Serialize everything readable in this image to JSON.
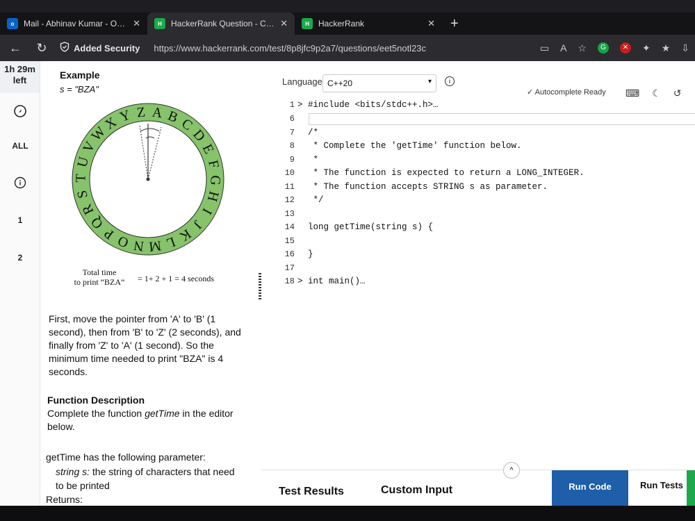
{
  "tabs": [
    {
      "label": "Mail - Abhinav Kumar - Outlook",
      "icon": "outlook-icon",
      "close": "✕"
    },
    {
      "label": "HackerRank Question - Circula",
      "icon": "hackerrank-icon",
      "close": "✕"
    },
    {
      "label": "HackerRank",
      "icon": "hackerrank-icon",
      "close": "✕"
    }
  ],
  "address": {
    "security_label": "Added Security",
    "url": "https://www.hackerrank.com/test/8p8jfc9p2a7/questions/eet5notl23c"
  },
  "leftnav": {
    "timer_line1": "1h 29m",
    "timer_line2": "left",
    "all_label": "ALL",
    "q1": "1",
    "q2": "2"
  },
  "problem": {
    "example_heading": "Example",
    "example_s": "s = \"BZA\"",
    "wheel_letters": [
      "Z",
      "A",
      "B",
      "C",
      "D",
      "E",
      "F",
      "G",
      "H",
      "I",
      "J",
      "K",
      "L",
      "M",
      "N",
      "O",
      "P",
      "Q",
      "R",
      "S",
      "T",
      "U",
      "V",
      "W",
      "X",
      "Y"
    ],
    "total_label_1": "Total time",
    "total_label_2": "to print “BZA”",
    "total_equation": "= 1+ 2 + 1 = 4 seconds",
    "paragraph": "First, move the pointer from 'A' to 'B' (1 second), then from 'B' to 'Z' (2 seconds), and finally from 'Z' to 'A' (1 second). So the minimum time needed to print \"BZA\" is 4 seconds.",
    "function_description_heading": "Function Description",
    "function_description_pre": "Complete the function ",
    "function_name": "getTime",
    "function_description_post": " in the editor below.",
    "param_line": "getTime has the following parameter:",
    "param_item_name": "string s:",
    "param_item_desc": " the string of characters that need to be printed",
    "returns_label": "Returns:"
  },
  "editor": {
    "language_label": "Language",
    "language_value": "C++20",
    "autocomplete_status": "Autocomplete Ready",
    "lines": [
      {
        "num": "1",
        "text": "> #include <bits/stdc++.h>…"
      },
      {
        "num": "6",
        "text": ""
      },
      {
        "num": "7",
        "text": "  /*"
      },
      {
        "num": "8",
        "text": "   * Complete the 'getTime' function below."
      },
      {
        "num": "9",
        "text": "   *"
      },
      {
        "num": "10",
        "text": "   * The function is expected to return a LONG_INTEGER."
      },
      {
        "num": "11",
        "text": "   * The function accepts STRING s as parameter."
      },
      {
        "num": "12",
        "text": "   */"
      },
      {
        "num": "13",
        "text": ""
      },
      {
        "num": "14",
        "text": "  long getTime(string s) {"
      },
      {
        "num": "15",
        "text": ""
      },
      {
        "num": "16",
        "text": "  }"
      },
      {
        "num": "17",
        "text": ""
      },
      {
        "num": "18",
        "text": "> int main()…"
      }
    ]
  },
  "bottom": {
    "test_results": "Test Results",
    "custom_input": "Custom Input",
    "run_code": "Run Code",
    "run_tests": "Run Tests"
  },
  "colors": {
    "wheel_green": "#86c36b",
    "run_code_blue": "#1f5ea8",
    "accent_green": "#1ba94c"
  }
}
